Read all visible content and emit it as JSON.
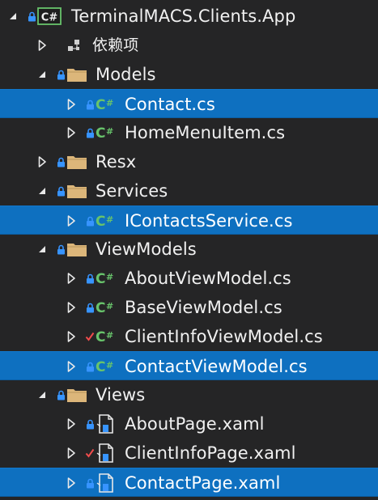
{
  "solution_explorer": {
    "items": [
      {
        "label": "TerminalMACS.Clients.App",
        "depth": 0,
        "expander": "expanded",
        "status": "lock",
        "icon": "csharp-project-icon",
        "selected": false
      },
      {
        "label": "依赖项",
        "depth": 1,
        "expander": "collapsed",
        "status": "none",
        "icon": "dependencies-icon",
        "selected": false
      },
      {
        "label": "Models",
        "depth": 1,
        "expander": "expanded",
        "status": "lock",
        "icon": "folder-icon",
        "selected": false
      },
      {
        "label": "Contact.cs",
        "depth": 2,
        "expander": "collapsed",
        "status": "lock",
        "icon": "csharp-file-icon",
        "selected": true
      },
      {
        "label": "HomeMenuItem.cs",
        "depth": 2,
        "expander": "collapsed",
        "status": "lock",
        "icon": "csharp-file-icon",
        "selected": false
      },
      {
        "label": "Resx",
        "depth": 1,
        "expander": "collapsed",
        "status": "lock",
        "icon": "folder-icon",
        "selected": false
      },
      {
        "label": "Services",
        "depth": 1,
        "expander": "expanded",
        "status": "lock",
        "icon": "folder-icon",
        "selected": false
      },
      {
        "label": "IContactsService.cs",
        "depth": 2,
        "expander": "collapsed",
        "status": "lock",
        "icon": "csharp-file-icon",
        "selected": true
      },
      {
        "label": "ViewModels",
        "depth": 1,
        "expander": "expanded",
        "status": "lock",
        "icon": "folder-icon",
        "selected": false
      },
      {
        "label": "AboutViewModel.cs",
        "depth": 2,
        "expander": "collapsed",
        "status": "lock",
        "icon": "csharp-file-icon",
        "selected": false
      },
      {
        "label": "BaseViewModel.cs",
        "depth": 2,
        "expander": "collapsed",
        "status": "lock",
        "icon": "csharp-file-icon",
        "selected": false
      },
      {
        "label": "ClientInfoViewModel.cs",
        "depth": 2,
        "expander": "collapsed",
        "status": "check",
        "icon": "csharp-file-icon",
        "selected": false
      },
      {
        "label": "ContactViewModel.cs",
        "depth": 2,
        "expander": "collapsed",
        "status": "lock",
        "icon": "csharp-file-icon",
        "selected": true
      },
      {
        "label": "Views",
        "depth": 1,
        "expander": "expanded",
        "status": "lock",
        "icon": "folder-icon",
        "selected": false
      },
      {
        "label": "AboutPage.xaml",
        "depth": 2,
        "expander": "collapsed",
        "status": "lock",
        "icon": "xaml-file-icon",
        "selected": false
      },
      {
        "label": "ClientInfoPage.xaml",
        "depth": 2,
        "expander": "collapsed",
        "status": "check",
        "icon": "xaml-file-icon",
        "selected": false
      },
      {
        "label": "ContactPage.xaml",
        "depth": 2,
        "expander": "collapsed",
        "status": "lock",
        "icon": "xaml-file-icon",
        "selected": true
      }
    ]
  },
  "colors": {
    "background": "#252526",
    "selection": "#0e70c0",
    "text": "#f1f1f1",
    "lock": "#3794ff",
    "check": "#f14c4c",
    "folder": "#dcb67a",
    "csharp": "#68c36b"
  }
}
